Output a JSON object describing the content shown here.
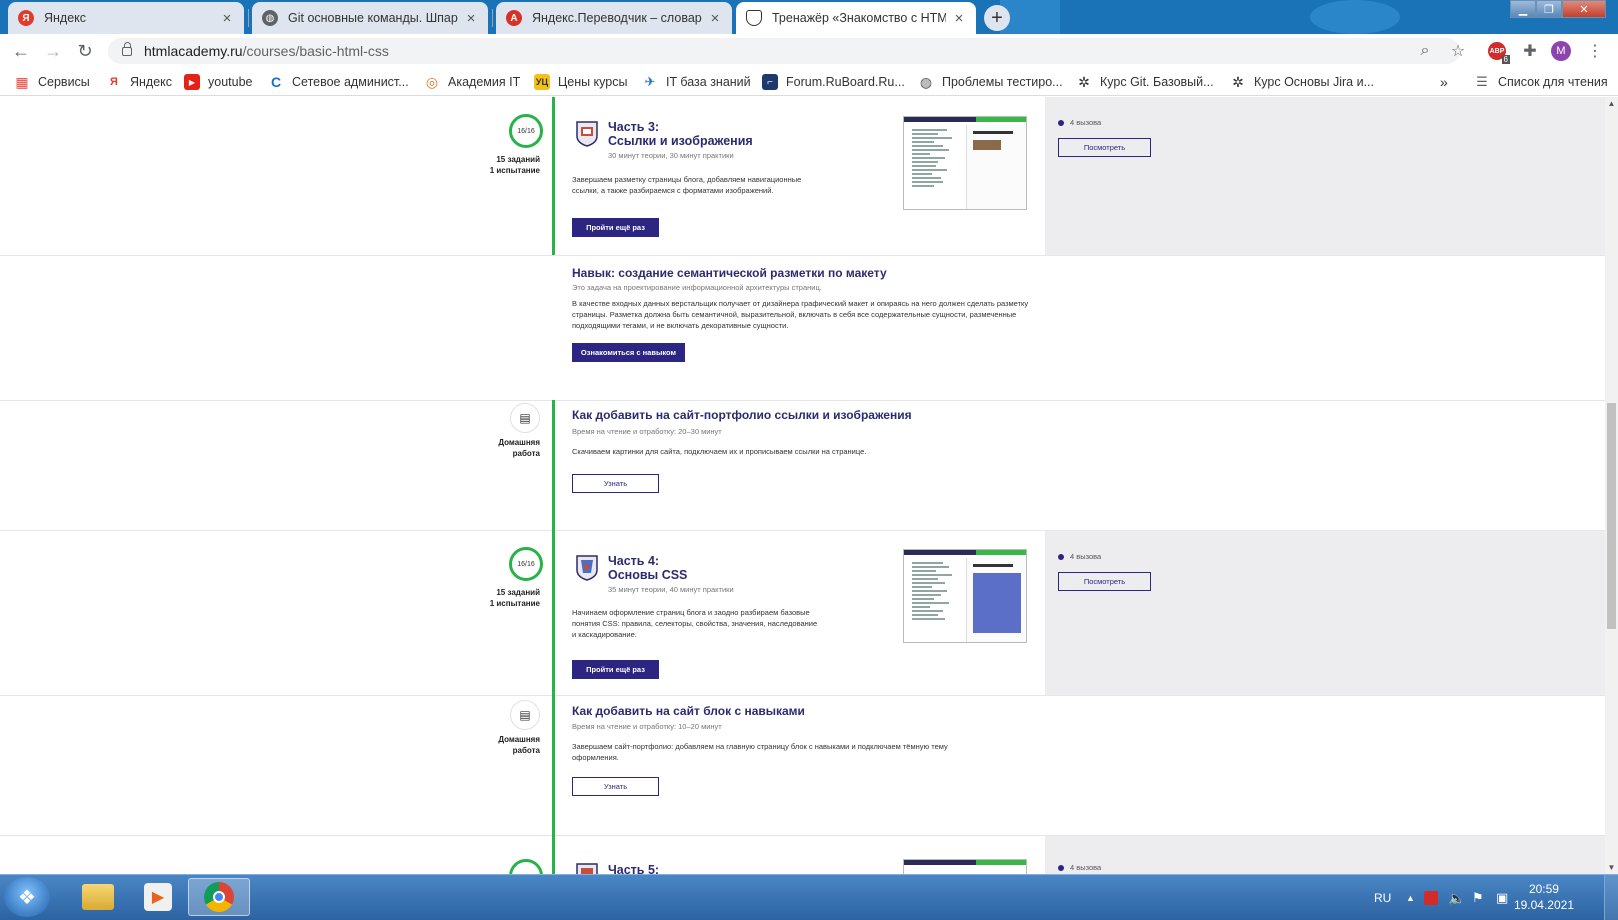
{
  "browser": {
    "tabs": [
      {
        "title": "Яндекс",
        "favicon": "yandex-icon",
        "color": "#e23b2e"
      },
      {
        "title": "Git основные команды. Шпарга",
        "favicon": "globe-icon",
        "color": "#5f6368"
      },
      {
        "title": "Яндекс.Переводчик – словарь и",
        "favicon": "yandex-translate-icon",
        "color": "#d6322a"
      },
      {
        "title": "Тренажёр «Знакомство с HTML",
        "favicon": "htmlacademy-shield-icon",
        "color": "#333333"
      }
    ],
    "url_host": "htmlacademy.ru",
    "url_path": "/courses/basic-html-css",
    "profile_initial": "M",
    "extension_badge": "6",
    "bookmarks": [
      {
        "label": "Сервисы",
        "icon": "apps-grid-icon"
      },
      {
        "label": "Яндекс",
        "icon": "yandex-icon"
      },
      {
        "label": "youtube",
        "icon": "youtube-icon"
      },
      {
        "label": "Сетевое админист...",
        "icon": "site-icon"
      },
      {
        "label": "Академия IT",
        "icon": "academy-icon"
      },
      {
        "label": "Цены курсы",
        "icon": "prices-icon"
      },
      {
        "label": "IT база знаний",
        "icon": "kb-icon"
      },
      {
        "label": "Forum.RuBoard.Ru...",
        "icon": "forum-icon"
      },
      {
        "label": "Проблемы тестиро...",
        "icon": "globe-icon"
      },
      {
        "label": "Курс Git. Базовый...",
        "icon": "openai-like-icon"
      },
      {
        "label": "Курс Основы Jira и...",
        "icon": "openai-like-icon"
      }
    ],
    "more_bookmarks": "»",
    "reading_list": "Список для чтения"
  },
  "course": {
    "part3": {
      "progress": "16/16",
      "meta_tasks": "15 заданий",
      "meta_test": "1 испытание",
      "title_line1": "Часть 3:",
      "title_line2": "Ссылки и изображения",
      "duration": "30 минут теории, 30 минут практики",
      "description": "Завершаем разметку страницы блога, добавляем навигационные ссылки, а также разбираемся с форматами изображений.",
      "button": "Пройти ещё раз",
      "calls": "4 вызова",
      "view_button": "Посмотреть"
    },
    "skill": {
      "title": "Навык: создание семантической разметки по макету",
      "subtitle": "Это задача на проектирование информационной архитектуры страниц.",
      "description": "В качестве входных данных верстальщик получает от дизайнера графический макет и опираясь на него должен сделать разметку страницы. Разметка должна быть семантичной, выразительной, включать в себя все содержательные сущности, размеченные подходящими тегами, и не включать декоративные сущности.",
      "button": "Ознакомиться с навыком"
    },
    "hw1": {
      "meta_line1": "Домашняя",
      "meta_line2": "работа",
      "title": "Как добавить на сайт-портфолио ссылки и изображения",
      "duration": "Время на чтение и отработку: 20–30 минут",
      "description": "Скачиваем картинки для сайта, подключаем их и прописываем ссылки на странице.",
      "button": "Узнать"
    },
    "part4": {
      "progress": "16/16",
      "meta_tasks": "15 заданий",
      "meta_test": "1 испытание",
      "title_line1": "Часть 4:",
      "title_line2": "Основы CSS",
      "duration": "35 минут теории, 40 минут практики",
      "description": "Начинаем оформление страниц блога и заодно разбираем базовые понятия CSS: правила, селекторы, свойства, значения, наследование и каскадирование.",
      "button": "Пройти ещё раз",
      "calls": "4 вызова",
      "view_button": "Посмотреть"
    },
    "hw2": {
      "meta_line1": "Домашняя",
      "meta_line2": "работа",
      "title": "Как добавить на сайт блок с навыками",
      "duration": "Время на чтение и отработку: 10–20 минут",
      "description": "Завершаем сайт-портфолио: добавляем на главную страницу блок с навыками и подключаем тёмную тему оформления.",
      "button": "Узнать"
    },
    "part5": {
      "title_line1": "Часть 5:",
      "calls": "4 вызова"
    }
  },
  "taskbar": {
    "lang": "RU",
    "time": "20:59",
    "date": "19.04.2021"
  },
  "colors": {
    "accent": "#2c2582",
    "timeline": "#27b34a",
    "title": "#2c2b6f"
  }
}
